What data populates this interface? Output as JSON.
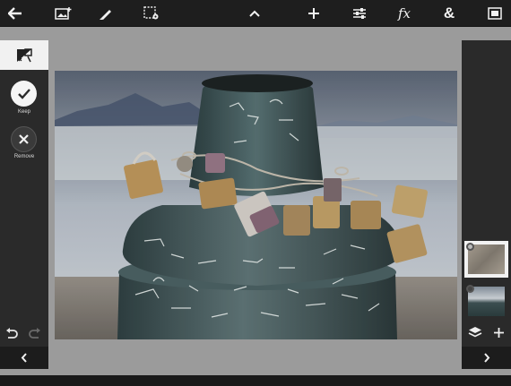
{
  "toolbar": {
    "icons": [
      "back-arrow-icon",
      "add-image-icon",
      "brush-icon",
      "selection-settings-icon",
      "collapse-up-icon",
      "add-icon",
      "adjustments-icon",
      "fx-icon",
      "text-ampersand-icon",
      "fit-screen-icon"
    ],
    "fx_label": "fx",
    "text_label": "&"
  },
  "left_panel": {
    "tool_icon": "mask-tool-icon",
    "keep_label": "Keep",
    "remove_label": "Remove"
  },
  "right_panel": {
    "layers_icon": "layers-icon",
    "add_layer_icon": "add-layer-icon"
  },
  "colors": {
    "toolbar_bg": "#1e1e1e",
    "panel_bg": "#2a2a2a",
    "workspace_bg": "#9b9b9b",
    "icon": "#f2f2f2"
  }
}
